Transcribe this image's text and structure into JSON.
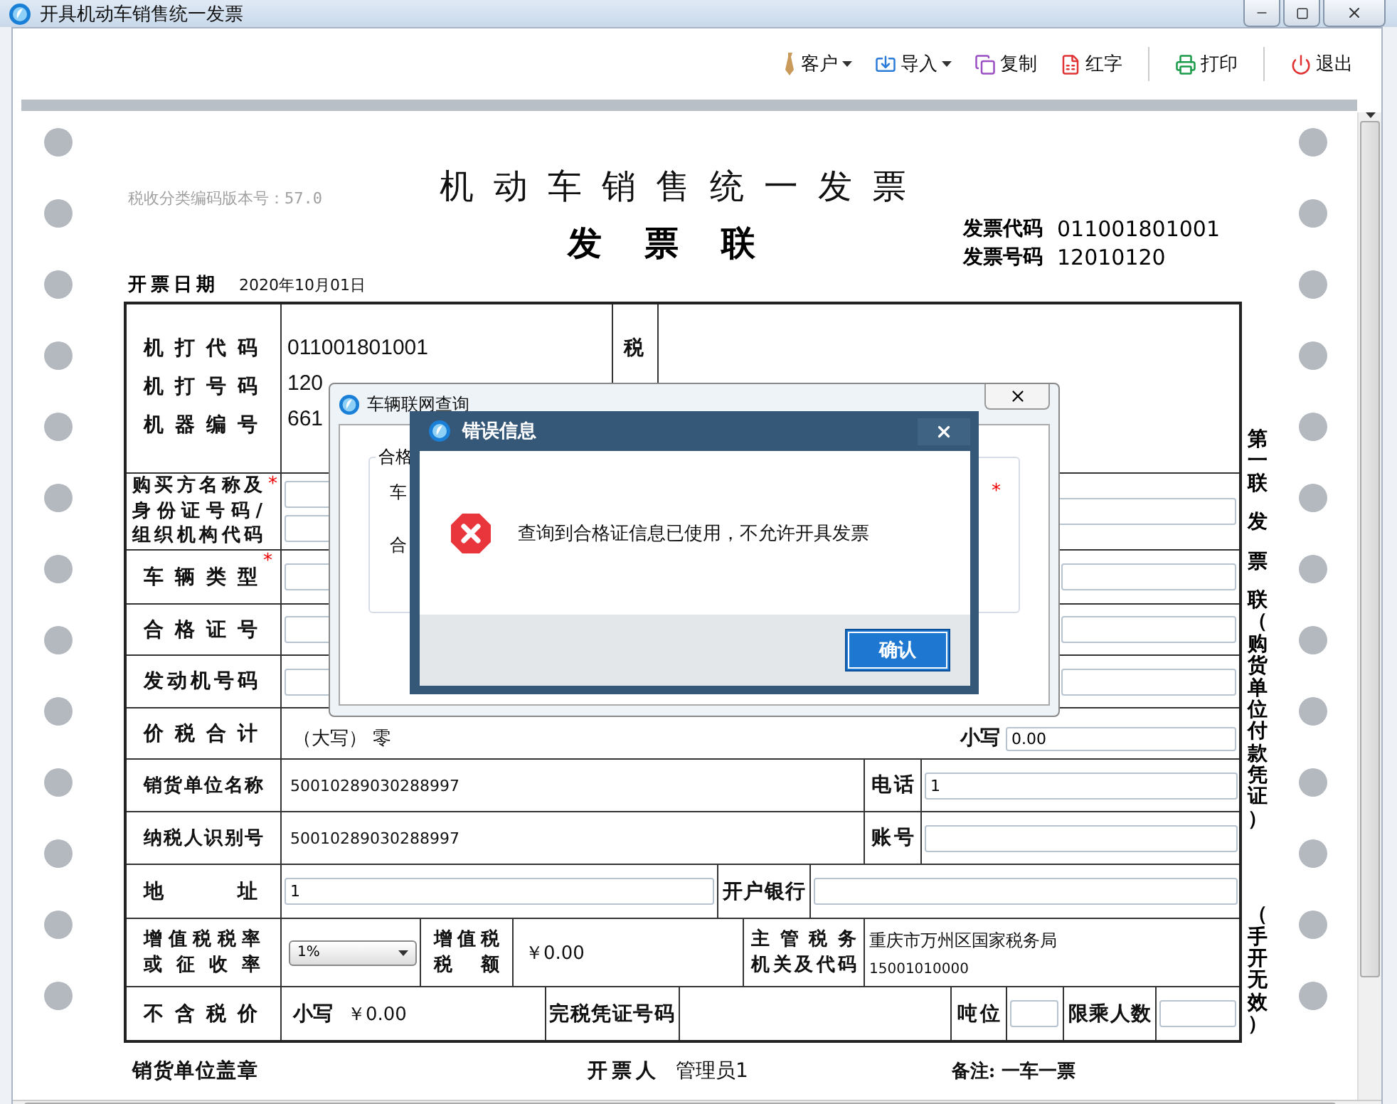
{
  "window": {
    "title": "开具机动车销售统一发票"
  },
  "toolbar": [
    {
      "kind": "tie",
      "label": "客户",
      "dropdown": true,
      "separator_before": false
    },
    {
      "kind": "import",
      "label": "导入",
      "dropdown": true,
      "separator_before": false
    },
    {
      "kind": "copy",
      "label": "复制",
      "dropdown": false,
      "separator_before": false
    },
    {
      "kind": "sheet",
      "label": "红字",
      "dropdown": false,
      "separator_before": false
    },
    {
      "kind": "print",
      "label": "打印",
      "dropdown": false,
      "separator_before": true
    },
    {
      "kind": "power",
      "label": "退出",
      "dropdown": false,
      "separator_before": true
    }
  ],
  "invoice": {
    "code_version": "税收分类编码版本号：57.0",
    "title": "机动车销售统一发票",
    "subtitle": "发票联",
    "meta": [
      {
        "label": "发票代码",
        "value": "011001801001"
      },
      {
        "label": "发票号码",
        "value": "12010120"
      }
    ],
    "date": {
      "label": "开票日期",
      "value": "2020年10月01日"
    },
    "machine": [
      {
        "label": "机打代码",
        "value": "011001801001"
      },
      {
        "label": "机打号码",
        "value": "120"
      },
      {
        "label": "机器编号",
        "value": "661"
      }
    ],
    "tax_control_label": "税",
    "buyer": {
      "label_lines": [
        "购买方名称及",
        "身份证号码/",
        "组织机构代码"
      ],
      "mark": "*"
    },
    "vehicle_type": {
      "label": "车辆类型",
      "mark": "*"
    },
    "cert_no": {
      "label": "合格证号"
    },
    "engine_no": {
      "label": "发动机号码"
    },
    "total": {
      "label": "价税合计",
      "upper": "（大写） 零",
      "lower_label": "小写",
      "lower_value": "0.00"
    },
    "seller_name": {
      "label": "销货单位名称",
      "value": "50010289030288997",
      "side_label": "电话",
      "side_value": "1"
    },
    "taxpayer_id": {
      "label": "纳税人识别号",
      "value": "50010289030288997",
      "side_label": "账号"
    },
    "address": {
      "label": "地址",
      "value": "1",
      "bank_label": "开户银行"
    },
    "rate": {
      "label_lines": [
        "增值税税率",
        "或征收率"
      ],
      "value": "1%",
      "tax_label_lines": [
        "增值税",
        "税额"
      ],
      "tax": "￥0.00",
      "authority_label_lines": [
        "主管税务",
        "机关及代码"
      ],
      "authority": "重庆市万州区国家税务局",
      "authority_code": "15001010000"
    },
    "price": {
      "label": "不含税价",
      "value_label": "小写",
      "value": "￥0.00",
      "receipt_label": "完税凭证号码",
      "tonnage_label": "吨位",
      "seats_label": "限乘人数"
    },
    "footer": {
      "seal": "销货单位盖章",
      "drawer_label": "开票人",
      "drawer": "管理员1",
      "note": "备注: 一车一票"
    },
    "side_text": [
      "第一联",
      "发",
      "票",
      "联（购货单位付款凭证）"
    ],
    "side_note": "（手开无效）"
  },
  "query_dialog": {
    "title": "车辆联网查询",
    "group_title": "合格",
    "labels": [
      "车",
      "合"
    ],
    "mark": "*"
  },
  "error_dialog": {
    "title": "错误信息",
    "message": "查询到合格证信息已使用，不允许开具发票",
    "button": "确认"
  }
}
